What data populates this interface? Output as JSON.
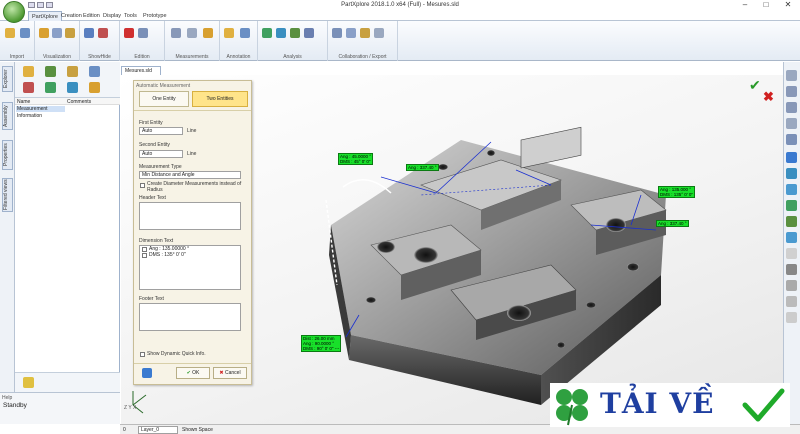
{
  "window": {
    "title": "PartXplore 2018.1.0 x64 (Full) - Mesures.sld"
  },
  "tabs": [
    "PartXplore",
    "Creation",
    "Edition",
    "Display",
    "Tools",
    "Prototype"
  ],
  "ribbon_groups": [
    "Import",
    "Visualization",
    "ShowHide",
    "Edition",
    "Measurements",
    "Annotation",
    "Analysis",
    "Collaboration / Export"
  ],
  "left_tabs": [
    "Explorer",
    "Assembly",
    "Properties",
    "Filtered views"
  ],
  "left_panel": {
    "columns": [
      "Name",
      "Comments"
    ],
    "rows": [
      "Measurement",
      "Information"
    ]
  },
  "help": {
    "label": "Help",
    "status": "Standby"
  },
  "document_tab": "Mesures.sld",
  "dialog": {
    "title": "Automatic Measurement",
    "one_entity": "One Entity",
    "two_entities": "Two Entities",
    "first_entity_label": "First Entity",
    "first_entity_value": "Auto",
    "first_entity_type": "Line",
    "second_entity_label": "Second Entity",
    "second_entity_value": "Auto",
    "second_entity_type": "Line",
    "measurement_type_label": "Measurement Type",
    "measurement_type_value": "Min Distance and Angle",
    "diameter_option": "Create Diameter Measurements instead of Radius",
    "header_text_label": "Header Text",
    "dimension_text_label": "Dimension Text",
    "dimension_lines": [
      "Ang : 135.00000 °",
      "DMS : 135° 0' 0\""
    ],
    "footer_text_label": "Footer Text",
    "show_info": "Show Dynamic Quick Info.",
    "ok": "OK",
    "cancel": "Cancel"
  },
  "annotations": {
    "a1": [
      "Ang : 45.0000 °",
      "DMS : 45° 0' 0\""
    ],
    "a2": [
      "Ang : 337.40 °"
    ],
    "a3": [
      "Ang : 135.000 °",
      "DMS : 135° 0' 0\""
    ],
    "a4": [
      "Ang : 337.40 °"
    ],
    "a5": [
      "Dist : 26.00 mm",
      "Ang : 90.0000 °",
      "DMS : 90° 0' 0\" ---"
    ]
  },
  "status": {
    "layer": "Layer_0",
    "space": "Shown Space",
    "zero": "0"
  },
  "watermark": {
    "text": "TẢI VỀ"
  },
  "colors": {
    "accent": "#18e02a",
    "ribbon": "#e4ebf4",
    "dialog": "#f7f3e6",
    "watermark_blue": "#1f3fa0"
  }
}
